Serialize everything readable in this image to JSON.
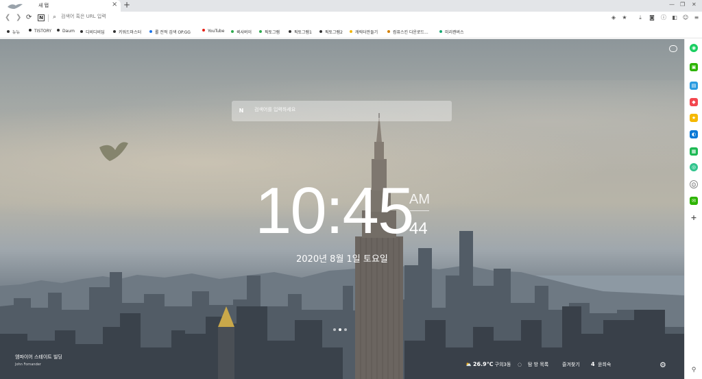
{
  "tabs": [
    {
      "title": "새 탭",
      "close": "×"
    }
  ],
  "new_tab_label": "+",
  "window_controls": [
    "—",
    "❐",
    "✕"
  ],
  "address_bar": {
    "placeholder": "검색어 혹은 URL 입력",
    "site_icon": "N"
  },
  "bookmarks": [
    {
      "label": "뉴뉴",
      "color": "#333333"
    },
    {
      "label": "TISTORY",
      "color": "#222222"
    },
    {
      "label": "Daum",
      "color": "#333333"
    },
    {
      "label": "디비디비딥",
      "color": "#333333"
    },
    {
      "label": "키워드마스터",
      "color": "#333333"
    },
    {
      "label": "롤 전적 검색 OP.GG",
      "color": "#1a73e8"
    },
    {
      "label": "YouTube",
      "color": "#e62117"
    },
    {
      "label": "퀵사버이",
      "color": "#2eaa4e"
    },
    {
      "label": "픽토그램",
      "color": "#2eaa4e"
    },
    {
      "label": "픽토그램1",
      "color": "#333333"
    },
    {
      "label": "픽토그램2",
      "color": "#333333"
    },
    {
      "label": "캐릭터만들기",
      "color": "#f1b500"
    },
    {
      "label": "컴퓨스킨 다운로드...",
      "color": "#d47f00"
    },
    {
      "label": "미리캔버스",
      "color": "#19a974"
    }
  ],
  "search": {
    "icon": "N",
    "placeholder": "검색어를 입력하세요"
  },
  "clock": {
    "time": "10:45",
    "ampm": "AM",
    "seconds": "44",
    "date": "2020년 8월 1일 토요일"
  },
  "pager": {
    "count": 3,
    "active": 1
  },
  "photo": {
    "location": "엠파이어 스테이트 빌딩",
    "credit": "John Fornander"
  },
  "bottom_bar": {
    "weather_temp": "26.9℃",
    "weather_place": "구의3동",
    "frequent_label": "탐 방 목록",
    "favorites_label": "즐겨찾기",
    "rank_num": "4",
    "rank_label": "윤희숙"
  },
  "colors": {
    "accent": "#19ce60"
  }
}
